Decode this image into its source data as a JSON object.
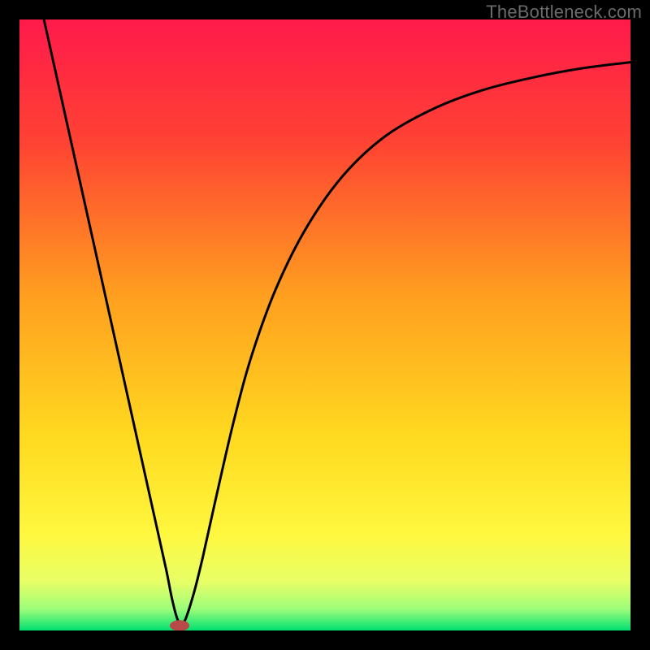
{
  "watermark": "TheBottleneck.com",
  "chart_data": {
    "type": "line",
    "title": "",
    "xlabel": "",
    "ylabel": "",
    "xlim": [
      0,
      100
    ],
    "ylim": [
      0,
      100
    ],
    "grid": false,
    "background_gradient": {
      "stops": [
        {
          "offset": 0.0,
          "color": "#ff1a4b"
        },
        {
          "offset": 0.2,
          "color": "#ff4233"
        },
        {
          "offset": 0.45,
          "color": "#ff9e1f"
        },
        {
          "offset": 0.68,
          "color": "#ffd91f"
        },
        {
          "offset": 0.84,
          "color": "#fff73e"
        },
        {
          "offset": 0.92,
          "color": "#e8ff66"
        },
        {
          "offset": 0.965,
          "color": "#9dfd7a"
        },
        {
          "offset": 1.0,
          "color": "#00e070"
        }
      ]
    },
    "series": [
      {
        "name": "bottleneck-curve",
        "stroke": "#000000",
        "x": [
          4.0,
          8.0,
          12.0,
          16.0,
          20.0,
          22.0,
          24.0,
          25.0,
          26.0,
          27.0,
          28.5,
          30.0,
          32.0,
          35.0,
          38.0,
          42.0,
          47.0,
          53.0,
          60.0,
          68.0,
          76.0,
          84.0,
          92.0,
          100.0
        ],
        "y": [
          100.0,
          82.0,
          64.0,
          46.0,
          28.0,
          19.0,
          10.0,
          5.0,
          1.5,
          1.5,
          6.0,
          12.0,
          21.0,
          34.0,
          45.0,
          56.0,
          66.0,
          74.5,
          81.0,
          85.5,
          88.5,
          90.5,
          92.0,
          93.0
        ]
      }
    ],
    "marker": {
      "name": "min-point",
      "x": 26.2,
      "y": 0.8,
      "rx": 1.6,
      "ry": 0.9,
      "fill": "#b84a4a"
    }
  }
}
